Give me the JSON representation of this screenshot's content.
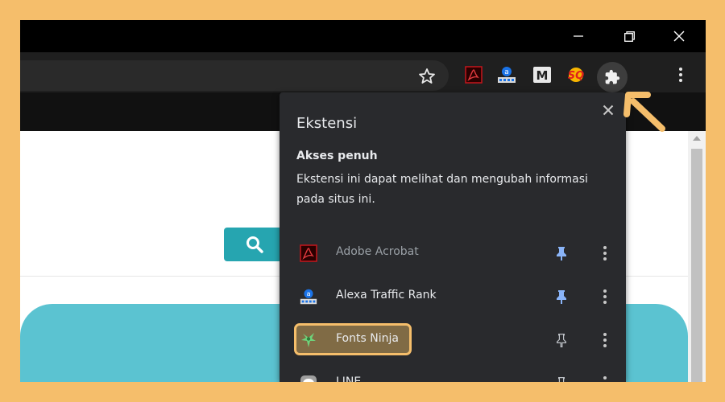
{
  "colors": {
    "background_frame": "#f5be6b",
    "popup_bg": "#292a2d",
    "accent_pin": "#8ab4f8",
    "teal": "#26a5b0",
    "highlight": "#f5be6b"
  },
  "window": {
    "controls": [
      "minimize-icon",
      "restore-icon",
      "close-icon"
    ]
  },
  "toolbar": {
    "icons": [
      "star-icon",
      "adobe-acrobat-icon",
      "alexa-icon",
      "m-extension-icon",
      "sq-extension-icon",
      "puzzle-icon",
      "menu-icon"
    ],
    "sq_label": "SQ",
    "m_label": "M",
    "alexa_label": "a"
  },
  "popup": {
    "title": "Ekstensi",
    "section_title": "Akses penuh",
    "section_desc": "Ekstensi ini dapat melihat dan mengubah informasi pada situs ini.",
    "extensions": [
      {
        "name": "Adobe Acrobat",
        "icon": "adobe-acrobat-icon",
        "pinned": true,
        "enabled": false
      },
      {
        "name": "Alexa Traffic Rank",
        "icon": "alexa-icon",
        "pinned": true,
        "enabled": true
      },
      {
        "name": "Fonts Ninja",
        "icon": "fonts-ninja-icon",
        "pinned": false,
        "enabled": true,
        "highlighted": true
      },
      {
        "name": "LINE",
        "icon": "line-icon",
        "pinned": false,
        "enabled": true
      }
    ]
  }
}
